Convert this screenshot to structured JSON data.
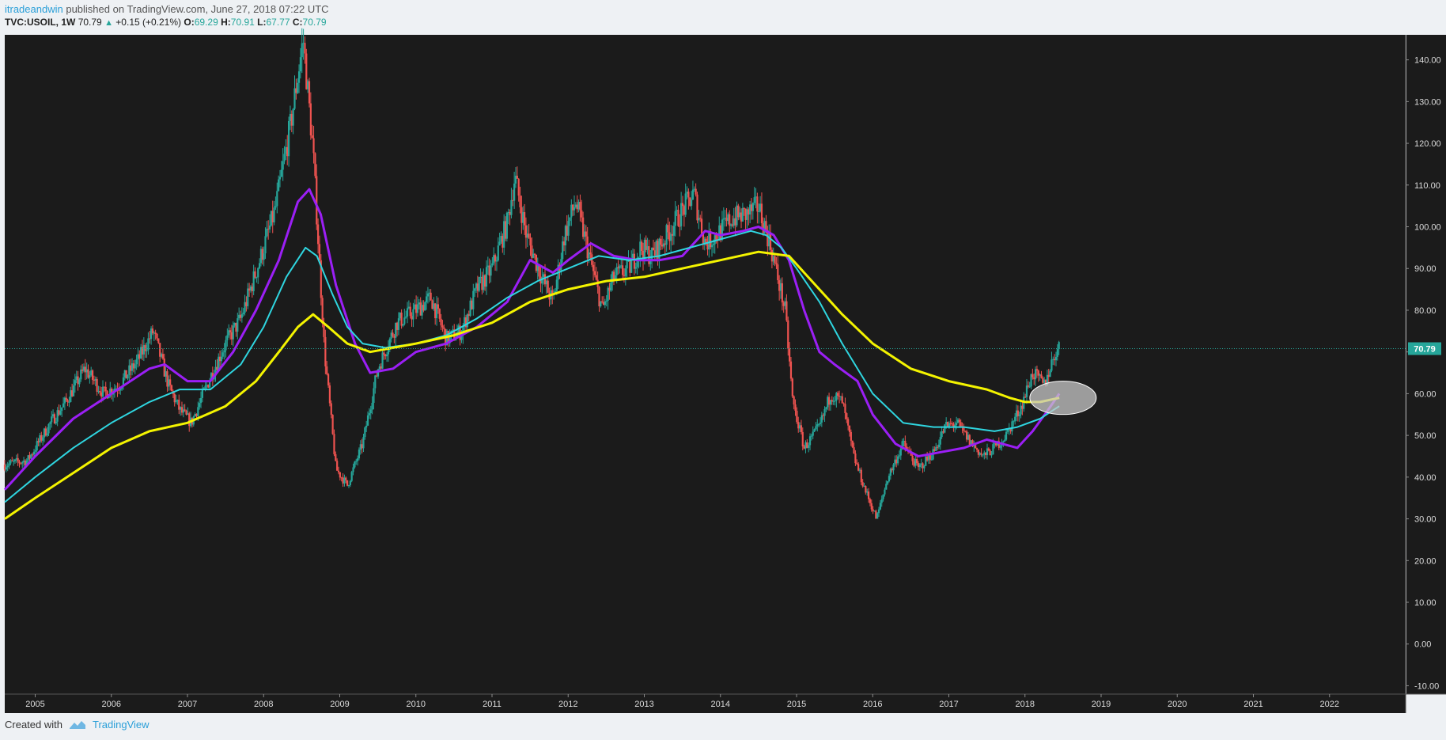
{
  "header": {
    "author": "itradeandwin",
    "published": "published on TradingView.com, June 27, 2018 07:22 UTC",
    "symbol": "TVC:USOIL, 1W",
    "last": "70.79",
    "change": "+0.15 (+0.21%)",
    "o_label": "O:",
    "o_value": "69.29",
    "h_label": "H:",
    "h_value": "70.91",
    "l_label": "L:",
    "l_value": "67.77",
    "c_label": "C:",
    "c_value": "70.79"
  },
  "footer": {
    "created_with": "Created with",
    "brand": "TradingView"
  },
  "colors": {
    "background": "#1b1b1b",
    "up": "#26a69a",
    "down": "#ef5350",
    "ma_short": "#9b1ff5",
    "ma_mid": "#2fd6e0",
    "ma_long": "#f4f400",
    "price_tag": "#26a69a"
  },
  "chart_data": {
    "type": "line",
    "symbol": "TVC:USOIL",
    "interval": "1W",
    "x_ticks": [
      "2005",
      "2006",
      "2007",
      "2008",
      "2009",
      "2010",
      "2011",
      "2012",
      "2013",
      "2014",
      "2015",
      "2016",
      "2017",
      "2018",
      "2019",
      "2020",
      "2021",
      "2022"
    ],
    "y_ticks": [
      140,
      130,
      120,
      110,
      100,
      90,
      80,
      70,
      60,
      50,
      40,
      30,
      20,
      10,
      0,
      -10
    ],
    "y_tick_labels": [
      "140.00",
      "130.00",
      "120.00",
      "110.00",
      "100.00",
      "90.00",
      "80.00",
      "70.00",
      "60.00",
      "50.00",
      "40.00",
      "30.00",
      "20.00",
      "10.00",
      "0.00",
      "-10.00"
    ],
    "ylim": [
      -12,
      146
    ],
    "xlim": [
      2004.6,
      2023.0
    ],
    "last_price": 70.79,
    "last_price_label": "70.79",
    "price_series": {
      "x": [
        2004.6,
        2004.9,
        2005.2,
        2005.4,
        2005.65,
        2005.9,
        2006.1,
        2006.35,
        2006.55,
        2006.75,
        2006.9,
        2007.05,
        2007.3,
        2007.5,
        2007.7,
        2007.95,
        2008.15,
        2008.35,
        2008.52,
        2008.65,
        2008.8,
        2008.95,
        2009.1,
        2009.3,
        2009.5,
        2009.75,
        2010.0,
        2010.2,
        2010.4,
        2010.6,
        2010.8,
        2011.0,
        2011.2,
        2011.3,
        2011.45,
        2011.65,
        2011.8,
        2011.95,
        2012.1,
        2012.25,
        2012.45,
        2012.6,
        2012.8,
        2012.95,
        2013.1,
        2013.3,
        2013.5,
        2013.65,
        2013.8,
        2013.95,
        2014.15,
        2014.35,
        2014.5,
        2014.65,
        2014.85,
        2014.95,
        2015.1,
        2015.3,
        2015.45,
        2015.6,
        2015.75,
        2015.9,
        2016.05,
        2016.2,
        2016.4,
        2016.6,
        2016.8,
        2016.95,
        2017.1,
        2017.3,
        2017.45,
        2017.6,
        2017.75,
        2017.95,
        2018.1,
        2018.25,
        2018.4,
        2018.45
      ],
      "y": [
        43,
        44,
        53,
        58,
        66,
        60,
        62,
        68,
        75,
        62,
        56,
        53,
        64,
        72,
        78,
        92,
        104,
        124,
        145,
        118,
        70,
        42,
        38,
        48,
        66,
        77,
        80,
        83,
        73,
        75,
        85,
        90,
        101,
        112,
        98,
        88,
        82,
        98,
        106,
        95,
        80,
        88,
        90,
        95,
        93,
        98,
        104,
        108,
        96,
        98,
        102,
        103,
        105,
        96,
        80,
        58,
        47,
        52,
        60,
        58,
        45,
        37,
        30,
        40,
        48,
        42,
        46,
        52,
        53,
        48,
        45,
        47,
        50,
        57,
        65,
        62,
        70,
        71
      ]
    },
    "series": [
      {
        "x": [
          2004.6,
          2005.0,
          2005.5,
          2006.0,
          2006.5,
          2006.7,
          2007.0,
          2007.3,
          2007.6,
          2007.9,
          2008.2,
          2008.45,
          2008.6,
          2008.75,
          2008.95,
          2009.2,
          2009.4,
          2009.7,
          2010.0,
          2010.4,
          2010.8,
          2011.2,
          2011.5,
          2011.8,
          2012.0,
          2012.3,
          2012.6,
          2012.9,
          2013.2,
          2013.5,
          2013.8,
          2014.0,
          2014.3,
          2014.5,
          2014.7,
          2014.9,
          2015.1,
          2015.3,
          2015.5,
          2015.8,
          2016.0,
          2016.3,
          2016.6,
          2016.9,
          2017.2,
          2017.5,
          2017.7,
          2017.9,
          2018.1,
          2018.3,
          2018.45
        ],
        "y": [
          37,
          45,
          54,
          60,
          66,
          67,
          63,
          63,
          70,
          80,
          92,
          106,
          109,
          103,
          86,
          72,
          65,
          66,
          70,
          72,
          76,
          82,
          92,
          89,
          92,
          96,
          93,
          92,
          92,
          93,
          99,
          98,
          99,
          100,
          98,
          92,
          80,
          70,
          67,
          63,
          55,
          48,
          45,
          46,
          47,
          49,
          48,
          47,
          51,
          56,
          60
        ]
      },
      {
        "x": [
          2004.6,
          2005.0,
          2005.5,
          2006.0,
          2006.5,
          2006.9,
          2007.3,
          2007.7,
          2008.0,
          2008.3,
          2008.55,
          2008.7,
          2008.9,
          2009.1,
          2009.3,
          2009.6,
          2010.0,
          2010.4,
          2010.8,
          2011.2,
          2011.6,
          2012.0,
          2012.4,
          2012.8,
          2013.2,
          2013.6,
          2014.0,
          2014.4,
          2014.6,
          2014.8,
          2015.0,
          2015.3,
          2015.6,
          2016.0,
          2016.4,
          2016.8,
          2017.2,
          2017.6,
          2017.9,
          2018.2,
          2018.45
        ],
        "y": [
          34,
          40,
          47,
          53,
          58,
          61,
          61,
          67,
          76,
          88,
          95,
          93,
          84,
          76,
          72,
          71,
          72,
          74,
          78,
          83,
          87,
          90,
          93,
          92,
          93,
          95,
          97,
          99,
          98,
          95,
          90,
          82,
          72,
          60,
          53,
          52,
          52,
          51,
          52,
          54,
          57
        ]
      },
      {
        "x": [
          2004.6,
          2005.0,
          2005.5,
          2006.0,
          2006.5,
          2007.0,
          2007.5,
          2007.9,
          2008.2,
          2008.45,
          2008.65,
          2008.85,
          2009.1,
          2009.4,
          2009.7,
          2010.0,
          2010.5,
          2011.0,
          2011.5,
          2012.0,
          2012.5,
          2013.0,
          2013.5,
          2014.0,
          2014.5,
          2014.9,
          2015.2,
          2015.6,
          2016.0,
          2016.5,
          2017.0,
          2017.5,
          2017.8,
          2018.0,
          2018.2,
          2018.45
        ],
        "y": [
          30,
          35,
          41,
          47,
          51,
          53,
          57,
          63,
          70,
          76,
          79,
          76,
          72,
          70,
          71,
          72,
          74,
          77,
          82,
          85,
          87,
          88,
          90,
          92,
          94,
          93,
          87,
          79,
          72,
          66,
          63,
          61,
          59,
          58,
          58,
          59
        ]
      }
    ],
    "annotations": [
      {
        "type": "ellipse",
        "x": 2018.5,
        "y": 59
      }
    ]
  }
}
